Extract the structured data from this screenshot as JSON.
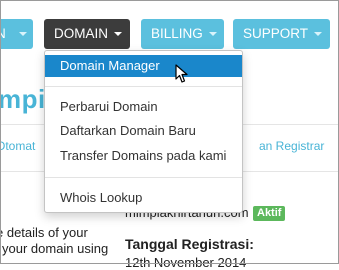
{
  "nav": {
    "left_partial": "N",
    "domain": "DOMAIN",
    "billing": "BILLING",
    "support": "SUPPORT"
  },
  "logo_partial": "mpi",
  "subnav": {
    "left": "Otomat",
    "right": "an Registrar"
  },
  "dropdown": {
    "items": [
      "Domain Manager",
      "Perbarui Domain",
      "Daftarkan Domain Baru",
      "Transfer Domains pada kami",
      "Whois Lookup"
    ],
    "active_index": 0
  },
  "content": {
    "line1": "e details of your",
    "line2": "your domain using",
    "domain_name": "mimpiakhirtahun.com",
    "status": "Aktif",
    "reg_label": "Tanggal Registrasi:",
    "reg_date": "12th November 2014"
  },
  "colors": {
    "nav_light": "#5bc0de",
    "nav_dark": "#3c3c3c",
    "active": "#1a87cb",
    "badge": "#5cb85c"
  }
}
